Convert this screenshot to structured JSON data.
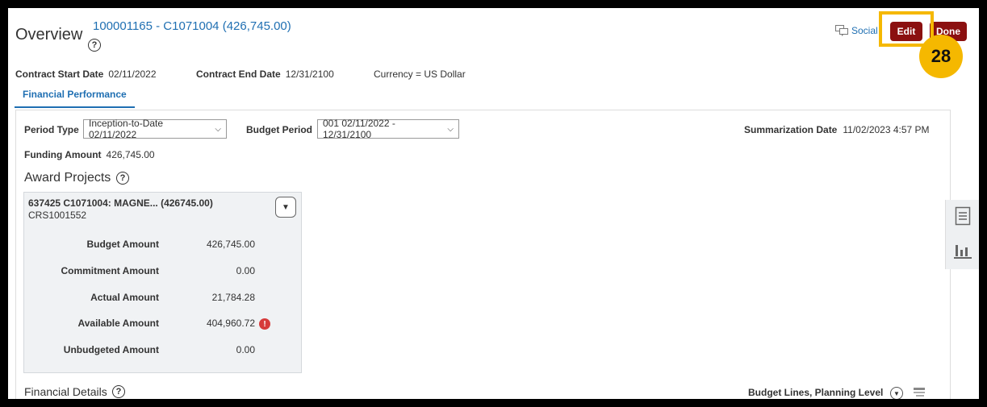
{
  "header": {
    "title": "Overview",
    "contract_link": "100001165 - C1071004 (426,745.00)",
    "help": "?",
    "social_label": "Social",
    "edit_label": "Edit",
    "done_label": "Done",
    "step_badge": "28"
  },
  "contract": {
    "start_label": "Contract Start Date",
    "start_value": "02/11/2022",
    "end_label": "Contract End Date",
    "end_value": "12/31/2100",
    "currency": "Currency = US Dollar"
  },
  "tabs": [
    {
      "label": "Financial Performance",
      "active": true
    }
  ],
  "filters": {
    "period_type_label": "Period Type",
    "period_type_value": "Inception-to-Date 02/11/2022",
    "budget_period_label": "Budget Period",
    "budget_period_value": "001 02/11/2022 - 12/31/2100",
    "summarization_label": "Summarization Date",
    "summarization_value": "11/02/2023 4:57 PM"
  },
  "funding": {
    "label": "Funding Amount",
    "value": "426,745.00"
  },
  "award_projects": {
    "heading": "Award Projects",
    "card": {
      "title": "637425 C1071004: MAGNE... (426745.00)",
      "subtitle": "CRS1001552",
      "rows": [
        {
          "label": "Budget Amount",
          "value": "426,745.00"
        },
        {
          "label": "Commitment Amount",
          "value": "0.00"
        },
        {
          "label": "Actual Amount",
          "value": "21,784.28"
        },
        {
          "label": "Available Amount",
          "value": "404,960.72",
          "warning": "!"
        },
        {
          "label": "Unbudgeted Amount",
          "value": "0.00"
        }
      ]
    }
  },
  "financial_details": {
    "heading": "Financial Details",
    "view_label": "Budget Lines, Planning Level"
  },
  "colors": {
    "brand_red": "#8b1010",
    "link_blue": "#1f6fb2",
    "highlight": "#f5b800"
  }
}
